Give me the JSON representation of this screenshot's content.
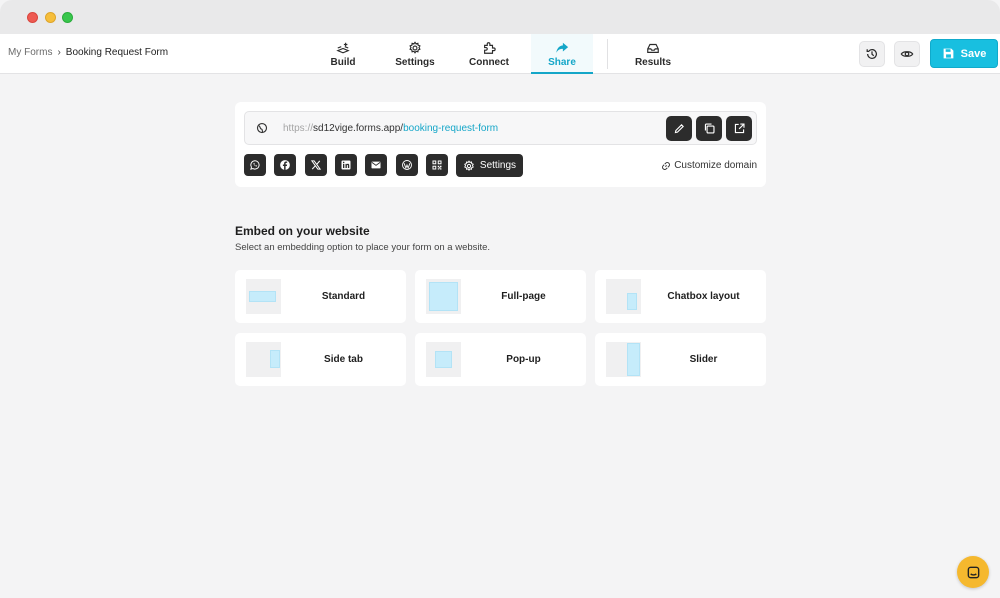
{
  "breadcrumb": {
    "parent": "My Forms",
    "separator": "›",
    "current": "Booking Request Form"
  },
  "nav": {
    "tabs": [
      {
        "label": "Build",
        "icon": "build-icon"
      },
      {
        "label": "Settings",
        "icon": "gear-icon"
      },
      {
        "label": "Connect",
        "icon": "puzzle-icon"
      },
      {
        "label": "Share",
        "icon": "share-arrow-icon",
        "active": true
      },
      {
        "label": "Results",
        "icon": "inbox-icon"
      }
    ],
    "save_label": "Save"
  },
  "share": {
    "url_protocol": "https://",
    "url_host": "sd12vige.forms.app/",
    "url_slug": "booking-request-form",
    "settings_label": "Settings",
    "customize_domain": "Customize domain",
    "social_icons": [
      "whatsapp-icon",
      "facebook-icon",
      "x-icon",
      "linkedin-icon",
      "email-icon",
      "wordpress-icon",
      "qr-code-icon"
    ]
  },
  "embed": {
    "title": "Embed on your website",
    "subtitle": "Select an embedding option to place your form on a website.",
    "options": [
      {
        "label": "Standard"
      },
      {
        "label": "Full-page"
      },
      {
        "label": "Chatbox layout"
      },
      {
        "label": "Side tab"
      },
      {
        "label": "Pop-up"
      },
      {
        "label": "Slider"
      }
    ]
  },
  "colors": {
    "accent": "#18bfe0",
    "dark_button": "#2c2c2c",
    "chat_fab": "#f5b82e"
  }
}
